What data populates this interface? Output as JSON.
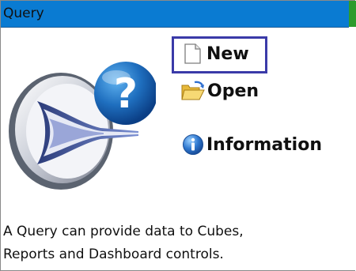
{
  "window": {
    "title": "Query"
  },
  "actions": {
    "new_label": "New",
    "open_label": "Open",
    "information_label": "Information"
  },
  "description": {
    "line1": "A Query can provide data to Cubes,",
    "line2": "Reports and Dashboard controls."
  },
  "icons": {
    "logo": "query-question-logo-icon",
    "new": "new-document-icon",
    "open": "open-folder-icon",
    "information": "information-icon"
  },
  "colors": {
    "titlebar": "#0a7bd2",
    "titlebar_accent": "#2d9b2d",
    "selection_border": "#3a3aa8"
  }
}
